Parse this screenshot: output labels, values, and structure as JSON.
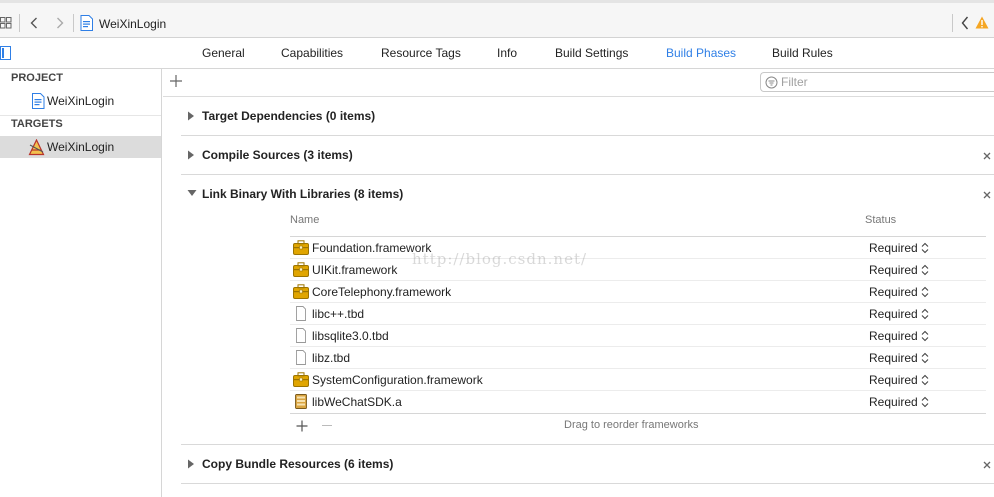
{
  "topbar": {
    "breadcrumb": "WeiXinLogin"
  },
  "tabs": [
    {
      "label": "General"
    },
    {
      "label": "Capabilities"
    },
    {
      "label": "Resource Tags"
    },
    {
      "label": "Info"
    },
    {
      "label": "Build Settings"
    },
    {
      "label": "Build Phases",
      "active": true
    },
    {
      "label": "Build Rules"
    }
  ],
  "sidebar": {
    "project_header": "PROJECT",
    "project_item": "WeiXinLogin",
    "targets_header": "TARGETS",
    "target_item": "WeiXinLogin"
  },
  "main": {
    "filter_placeholder": "Filter",
    "phases": [
      {
        "title": "Target Dependencies (0 items)",
        "expanded": false
      },
      {
        "title": "Compile Sources (3 items)",
        "expanded": false
      },
      {
        "title": "Link Binary With Libraries (8 items)",
        "expanded": true
      },
      {
        "title": "Copy Bundle Resources (6 items)",
        "expanded": false
      }
    ],
    "libraries": {
      "col_name": "Name",
      "col_status": "Status",
      "rows": [
        {
          "name": "Foundation.framework",
          "status": "Required",
          "icon": "framework-toolbox-icon"
        },
        {
          "name": "UIKit.framework",
          "status": "Required",
          "icon": "framework-toolbox-icon"
        },
        {
          "name": "CoreTelephony.framework",
          "status": "Required",
          "icon": "framework-toolbox-icon"
        },
        {
          "name": "libc++.tbd",
          "status": "Required",
          "icon": "document-icon"
        },
        {
          "name": "libsqlite3.0.tbd",
          "status": "Required",
          "icon": "document-icon"
        },
        {
          "name": "libz.tbd",
          "status": "Required",
          "icon": "document-icon"
        },
        {
          "name": "SystemConfiguration.framework",
          "status": "Required",
          "icon": "framework-toolbox-icon"
        },
        {
          "name": "libWeChatSDK.a",
          "status": "Required",
          "icon": "static-library-icon"
        }
      ],
      "footer_hint": "Drag to reorder frameworks"
    },
    "watermark": "http://blog.csdn.net/"
  },
  "colors": {
    "accent": "#2f7fe6",
    "warning": "#f5a623",
    "framework_icon": "#e0a500"
  }
}
